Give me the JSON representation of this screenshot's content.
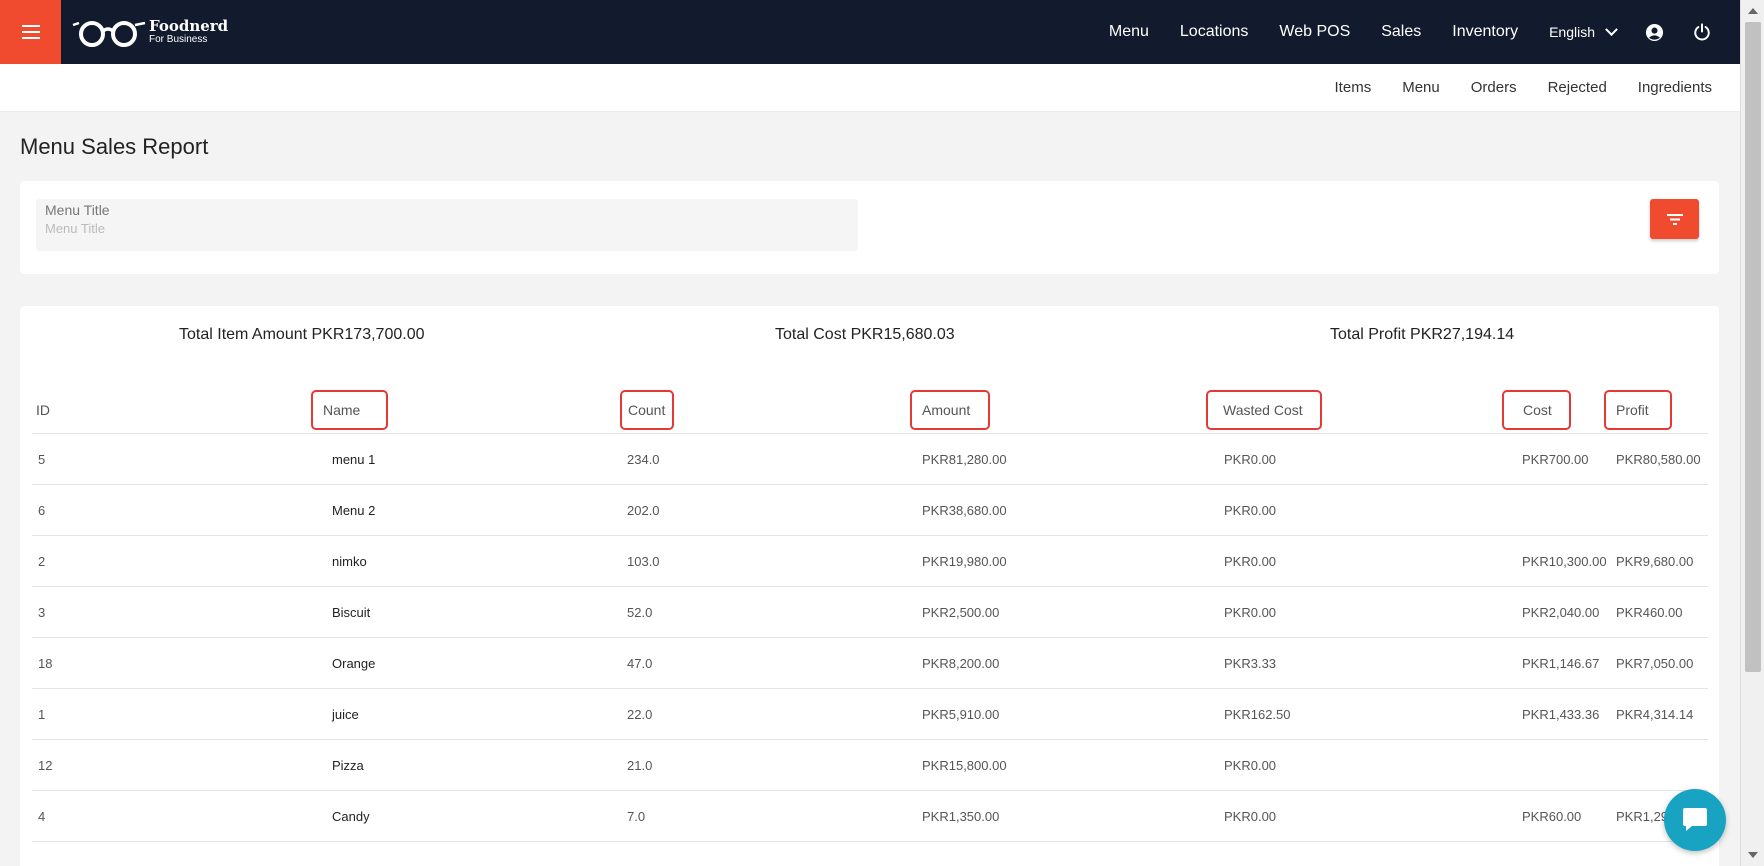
{
  "brand": {
    "name": "Foodnerd",
    "subtitle": "For Business",
    "accent": "#f04a2f",
    "navbar_bg": "#121a2d"
  },
  "nav": {
    "links": [
      "Menu",
      "Locations",
      "Web POS",
      "Sales",
      "Inventory"
    ],
    "language": "English"
  },
  "icons": {
    "menu": "hamburger-icon",
    "user": "user-circle-icon",
    "power": "power-icon",
    "filter": "filter-icon",
    "chat": "chat-icon"
  },
  "subnav": {
    "links": [
      "Items",
      "Menu",
      "Orders",
      "Rejected",
      "Ingredients"
    ]
  },
  "page": {
    "title": "Menu Sales Report"
  },
  "filter": {
    "label": "Menu Title",
    "placeholder": "Menu Title",
    "value": ""
  },
  "totals": {
    "item_amount": "Total Item Amount PKR173,700.00",
    "cost": "Total Cost PKR15,680.03",
    "profit": "Total Profit PKR27,194.14"
  },
  "table": {
    "headers": {
      "id": "ID",
      "name": "Name",
      "count": "Count",
      "amount": "Amount",
      "wasted": "Wasted Cost",
      "cost": "Cost",
      "profit": "Profit"
    },
    "rows": [
      {
        "id": "5",
        "name": "menu 1",
        "count": "234.0",
        "amount": "PKR81,280.00",
        "wasted": "PKR0.00",
        "cost": "PKR700.00",
        "profit": "PKR80,580.00"
      },
      {
        "id": "6",
        "name": "Menu 2",
        "count": "202.0",
        "amount": "PKR38,680.00",
        "wasted": "PKR0.00",
        "cost": "",
        "profit": ""
      },
      {
        "id": "2",
        "name": "nimko",
        "count": "103.0",
        "amount": "PKR19,980.00",
        "wasted": "PKR0.00",
        "cost": "PKR10,300.00",
        "profit": "PKR9,680.00"
      },
      {
        "id": "3",
        "name": "Biscuit",
        "count": "52.0",
        "amount": "PKR2,500.00",
        "wasted": "PKR0.00",
        "cost": "PKR2,040.00",
        "profit": "PKR460.00"
      },
      {
        "id": "18",
        "name": "Orange",
        "count": "47.0",
        "amount": "PKR8,200.00",
        "wasted": "PKR3.33",
        "cost": "PKR1,146.67",
        "profit": "PKR7,050.00"
      },
      {
        "id": "1",
        "name": "juice",
        "count": "22.0",
        "amount": "PKR5,910.00",
        "wasted": "PKR162.50",
        "cost": "PKR1,433.36",
        "profit": "PKR4,314.14"
      },
      {
        "id": "12",
        "name": "Pizza",
        "count": "21.0",
        "amount": "PKR15,800.00",
        "wasted": "PKR0.00",
        "cost": "",
        "profit": ""
      },
      {
        "id": "4",
        "name": "Candy",
        "count": "7.0",
        "amount": "PKR1,350.00",
        "wasted": "PKR0.00",
        "cost": "PKR60.00",
        "profit": "PKR1,29"
      }
    ]
  }
}
